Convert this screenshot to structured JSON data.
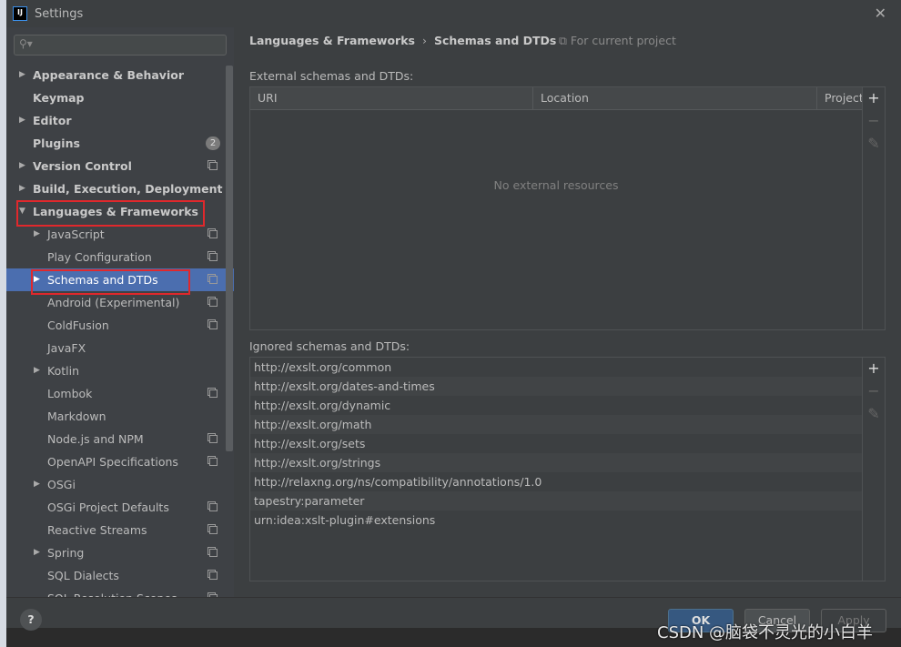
{
  "window": {
    "title": "Settings",
    "logo": "IJ"
  },
  "search": {
    "placeholder": ""
  },
  "sidebar": {
    "items": [
      {
        "label": "Appearance & Behavior",
        "level": 0,
        "expandable": true,
        "bold": true
      },
      {
        "label": "Keymap",
        "level": 0,
        "bold": true
      },
      {
        "label": "Editor",
        "level": 0,
        "expandable": true,
        "bold": true
      },
      {
        "label": "Plugins",
        "level": 0,
        "bold": true,
        "badge": "2"
      },
      {
        "label": "Version Control",
        "level": 0,
        "expandable": true,
        "bold": true,
        "project": true
      },
      {
        "label": "Build, Execution, Deployment",
        "level": 0,
        "expandable": true,
        "bold": true
      },
      {
        "label": "Languages & Frameworks",
        "level": 0,
        "expanded": true,
        "bold": true
      },
      {
        "label": "JavaScript",
        "level": 1,
        "expandable": true,
        "project": true
      },
      {
        "label": "Play Configuration",
        "level": 1,
        "project": true
      },
      {
        "label": "Schemas and DTDs",
        "level": 1,
        "expandable": true,
        "project": true,
        "selected": true
      },
      {
        "label": "Android (Experimental)",
        "level": 1,
        "project": true
      },
      {
        "label": "ColdFusion",
        "level": 1,
        "project": true
      },
      {
        "label": "JavaFX",
        "level": 1
      },
      {
        "label": "Kotlin",
        "level": 1,
        "expandable": true
      },
      {
        "label": "Lombok",
        "level": 1,
        "project": true
      },
      {
        "label": "Markdown",
        "level": 1
      },
      {
        "label": "Node.js and NPM",
        "level": 1,
        "project": true
      },
      {
        "label": "OpenAPI Specifications",
        "level": 1,
        "project": true
      },
      {
        "label": "OSGi",
        "level": 1,
        "expandable": true
      },
      {
        "label": "OSGi Project Defaults",
        "level": 1,
        "project": true
      },
      {
        "label": "Reactive Streams",
        "level": 1,
        "project": true
      },
      {
        "label": "Spring",
        "level": 1,
        "expandable": true,
        "project": true
      },
      {
        "label": "SQL Dialects",
        "level": 1,
        "project": true
      },
      {
        "label": "SQL Resolution Scopes",
        "level": 1,
        "project": true
      }
    ]
  },
  "breadcrumb": {
    "parent": "Languages & Frameworks",
    "separator": "›",
    "current": "Schemas and DTDs",
    "scope": "For current project"
  },
  "external": {
    "label": "External schemas and DTDs:",
    "columns": [
      "URI",
      "Location",
      "Project"
    ],
    "empty": "No external resources"
  },
  "ignored": {
    "label": "Ignored schemas and DTDs:",
    "rows": [
      "http://exslt.org/common",
      "http://exslt.org/dates-and-times",
      "http://exslt.org/dynamic",
      "http://exslt.org/math",
      "http://exslt.org/sets",
      "http://exslt.org/strings",
      "http://relaxng.org/ns/compatibility/annotations/1.0",
      "tapestry:parameter",
      "urn:idea:xslt-plugin#extensions"
    ]
  },
  "tools": {
    "add": "+",
    "remove": "−",
    "edit": "✎"
  },
  "footer": {
    "help": "?",
    "ok": "OK",
    "cancel": "Cancel",
    "apply": "Apply"
  },
  "watermark": "CSDN @脑袋不灵光的小白羊",
  "colors": {
    "selection": "#4b6eaf",
    "highlight_box": "#e0282c",
    "ok_button": "#365880"
  }
}
